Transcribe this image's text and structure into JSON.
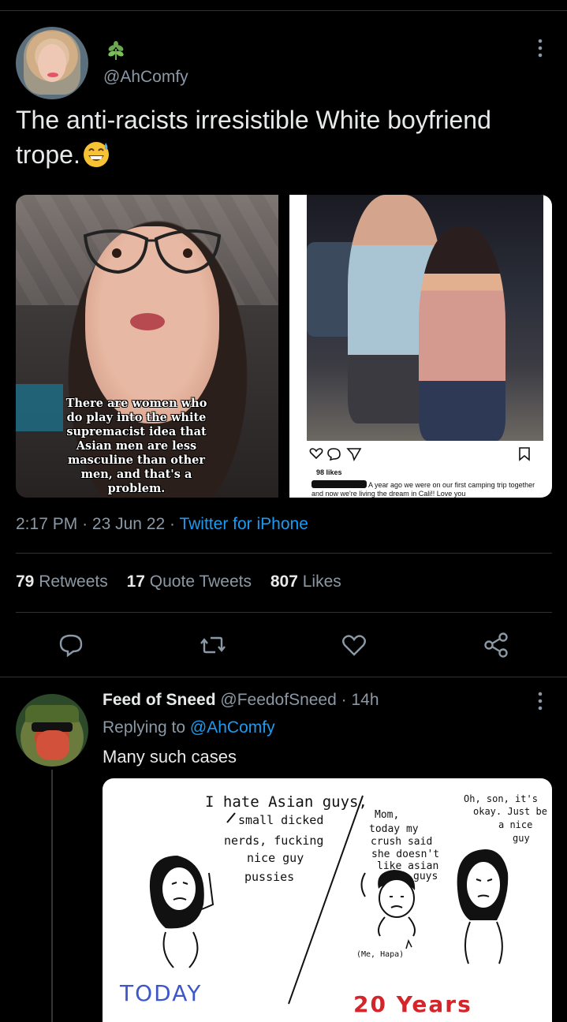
{
  "tweet": {
    "handle": "@AhComfy",
    "text": "The anti-racists irresistible White boyfriend trope.",
    "emoji": "grinning-sweat-emoji",
    "time": "2:17 PM",
    "date": "23 Jun 22",
    "source": "Twitter for iPhone",
    "dot": "·"
  },
  "media": {
    "left_overlay": "There are women who do play into the white supremacist idea that Asian men are less masculine than other men, and that's a problem.",
    "right_likes": "98 likes",
    "right_caption": "A year ago we were on our first camping trip together and now we're living the dream in Cali!! Love you"
  },
  "stats": {
    "retweets_count": "79",
    "retweets_label": "Retweets",
    "quotes_count": "17",
    "quotes_label": "Quote Tweets",
    "likes_count": "807",
    "likes_label": "Likes"
  },
  "reply": {
    "name": "Feed of Sneed",
    "handle": "@FeedofSneed",
    "time": "· 14h",
    "replying_prefix": "Replying to",
    "replying_handle": "@AhComfy",
    "text": "Many such cases"
  },
  "comic": {
    "left_speech": [
      "I hate Asian guys,",
      "small dicked",
      "nerds, fucking",
      "nice guy",
      "pussies"
    ],
    "middle_speech": [
      "Mom,",
      "today my",
      "crush said",
      "she doesn't",
      "like asian",
      "guys"
    ],
    "right_speech": [
      "Oh, son, it's",
      "okay. Just be",
      "a nice",
      "guy"
    ],
    "caption_small": "(Me, Hapa)",
    "today_label": "TODAY",
    "years_label": "20 Years"
  },
  "colors": {
    "background": "#000000",
    "text": "#e7e9ea",
    "muted": "#8b98a5",
    "accent": "#1d9bf0",
    "divider": "#2f3336"
  }
}
